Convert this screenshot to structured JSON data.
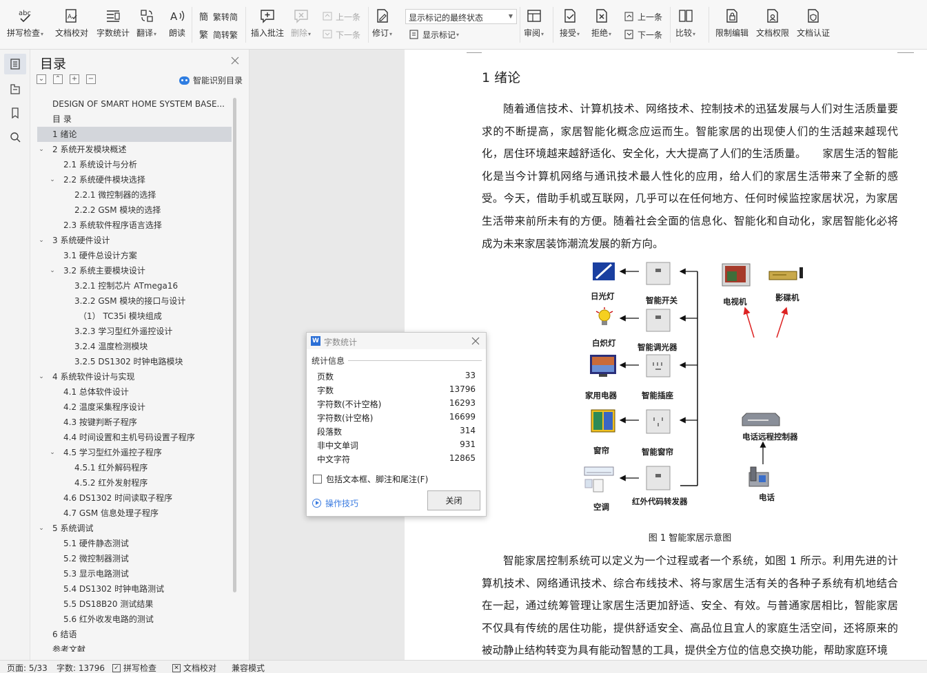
{
  "ribbon": {
    "spell_check": "拼写检查",
    "doc_proofread": "文档校对",
    "word_count": "字数统计",
    "translate": "翻译",
    "read_aloud": "朗读",
    "to_traditional": "繁转简",
    "to_simplified": "简转繁",
    "insert_comment": "插入批注",
    "delete": "删除",
    "prev_comment": "上一条",
    "next_comment": "下一条",
    "revise": "修订",
    "markup_state": "显示标记的最终状态",
    "show_markup": "显示标记",
    "review": "审阅",
    "accept": "接受",
    "reject": "拒绝",
    "prev_change": "上一条",
    "next_change": "下一条",
    "compare": "比较",
    "restrict_edit": "限制编辑",
    "doc_permission": "文档权限",
    "doc_certify": "文档认证"
  },
  "toc": {
    "title": "目录",
    "smart_toc": "智能识别目录",
    "items": [
      {
        "text": "DESIGN OF SMART HOME SYSTEM BASE...",
        "level": 0,
        "arrow": ""
      },
      {
        "text": "目  录",
        "level": 0,
        "arrow": ""
      },
      {
        "text": "1  绪论",
        "level": 0,
        "arrow": "",
        "selected": true
      },
      {
        "text": "2  系统开发模块概述",
        "level": 0,
        "arrow": "v"
      },
      {
        "text": "2.1  系统设计与分析",
        "level": 1,
        "arrow": ""
      },
      {
        "text": "2.2  系统硬件模块选择",
        "level": 1,
        "arrow": "v"
      },
      {
        "text": "2.2.1  微控制器的选择",
        "level": 2,
        "arrow": ""
      },
      {
        "text": "2.2.2 GSM 模块的选择",
        "level": 2,
        "arrow": ""
      },
      {
        "text": "2.3  系统软件程序语言选择",
        "level": 1,
        "arrow": ""
      },
      {
        "text": "3  系统硬件设计",
        "level": 0,
        "arrow": "v"
      },
      {
        "text": "3.1  硬件总设计方案",
        "level": 1,
        "arrow": ""
      },
      {
        "text": "3.2  系统主要模块设计",
        "level": 1,
        "arrow": "v"
      },
      {
        "text": "3.2.1  控制芯片 ATmega16",
        "level": 2,
        "arrow": ""
      },
      {
        "text": "3.2.2 GSM 模块的接口与设计",
        "level": 2,
        "arrow": ""
      },
      {
        "text": "（1）  TC35i 模块组成",
        "level": 3,
        "arrow": ""
      },
      {
        "text": "3.2.3  学习型红外遥控设计",
        "level": 2,
        "arrow": ""
      },
      {
        "text": "3.2.4  温度检测模块",
        "level": 2,
        "arrow": ""
      },
      {
        "text": "3.2.5 DS1302 时钟电路模块",
        "level": 2,
        "arrow": ""
      },
      {
        "text": "4  系统软件设计与实现",
        "level": 0,
        "arrow": "v"
      },
      {
        "text": "4.1  总体软件设计",
        "level": 1,
        "arrow": ""
      },
      {
        "text": "4.2  温度采集程序设计",
        "level": 1,
        "arrow": ""
      },
      {
        "text": "4.3  按键判断子程序",
        "level": 1,
        "arrow": ""
      },
      {
        "text": "4.4  时间设置和主机号码设置子程序",
        "level": 1,
        "arrow": ""
      },
      {
        "text": "4.5  学习型红外遥控子程序",
        "level": 1,
        "arrow": "v"
      },
      {
        "text": "4.5.1  红外解码程序",
        "level": 2,
        "arrow": ""
      },
      {
        "text": "4.5.2  红外发射程序",
        "level": 2,
        "arrow": ""
      },
      {
        "text": "4.6 DS1302 时间读取子程序",
        "level": 1,
        "arrow": ""
      },
      {
        "text": "4.7 GSM 信息处理子程序",
        "level": 1,
        "arrow": ""
      },
      {
        "text": "5  系统调试",
        "level": 0,
        "arrow": "v"
      },
      {
        "text": "5.1  硬件静态测试",
        "level": 1,
        "arrow": ""
      },
      {
        "text": "5.2  微控制器测试",
        "level": 1,
        "arrow": ""
      },
      {
        "text": "5.3  显示电路测试",
        "level": 1,
        "arrow": ""
      },
      {
        "text": "5.4 DS1302 时钟电路测试",
        "level": 1,
        "arrow": ""
      },
      {
        "text": "5.5 DS18B20 测试结果",
        "level": 1,
        "arrow": ""
      },
      {
        "text": "5.6  红外收发电路的测试",
        "level": 1,
        "arrow": ""
      },
      {
        "text": "6  结语",
        "level": 0,
        "arrow": ""
      },
      {
        "text": "参考文献",
        "level": 0,
        "arrow": ""
      }
    ]
  },
  "document": {
    "heading": "1  绪论",
    "para1": "随着通信技术、计算机技术、网络技术、控制技术的迅猛发展与人们对生活质量要求的不断提高，家居智能化概念应运而生。智能家居的出现使人们的生活越来越现代化，居住环境越来越舒适化、安全化，大大提高了人们的生活质量。　　家居生活的智能化是当今计算机网络与通讯技术最人性化的应用，给人们的家居生活带来了全新的感受。今天，借助手机或互联网，几乎可以在任何地方、任何时候监控家居状况，为家居生活带来前所未有的方便。随着社会全面的信息化、智能化和自动化，家居智能化必将成为未来家居装饰潮流发展的新方向。",
    "figure": {
      "caption": "图 1  智能家居示意图",
      "labels": {
        "fluorescent": "日光灯",
        "smart_switch": "智能开关",
        "incandescent": "白炽灯",
        "smart_dimmer": "智能调光器",
        "appliance": "家用电器",
        "smart_socket": "智能插座",
        "curtain": "窗帘",
        "smart_curtain": "智能窗帘",
        "aircon": "空调",
        "ir_forwarder": "红外代码转发器",
        "tv": "电视机",
        "dvd": "影碟机",
        "remote_ctrl": "电话远程控制器",
        "phone": "电话"
      }
    },
    "para2": "智能家居控制系统可以定义为一个过程或者一个系统，如图 1 所示。利用先进的计算机技术、网络通讯技术、综合布线技术、将与家居生活有关的各种子系统有机地结合在一起，通过统筹管理让家居生活更加舒适、安全、有效。与普通家居相比，智能家居不仅具有传统的居住功能，提供舒适安全、高品位且宜人的家庭生活空间，还将原来的被动静止结构转变为具有能动智慧的工具，提供全方位的信息交换功能，帮助家庭环境"
  },
  "dialog": {
    "title": "字数统计",
    "section": "统计信息",
    "rows": [
      {
        "k": "页数",
        "v": "33"
      },
      {
        "k": "字数",
        "v": "13796"
      },
      {
        "k": "字符数(不计空格)",
        "v": "16293"
      },
      {
        "k": "字符数(计空格)",
        "v": "16699"
      },
      {
        "k": "段落数",
        "v": "314"
      },
      {
        "k": "非中文单词",
        "v": "931"
      },
      {
        "k": "中文字符",
        "v": "12865"
      }
    ],
    "include_label": "包括文本框、脚注和尾注(F)",
    "tips": "操作技巧",
    "close": "关闭"
  },
  "status": {
    "page": "页面: 5/33",
    "words": "字数: 13796",
    "spell": "拼写检查",
    "proof": "文档校对",
    "compat": "兼容模式"
  }
}
